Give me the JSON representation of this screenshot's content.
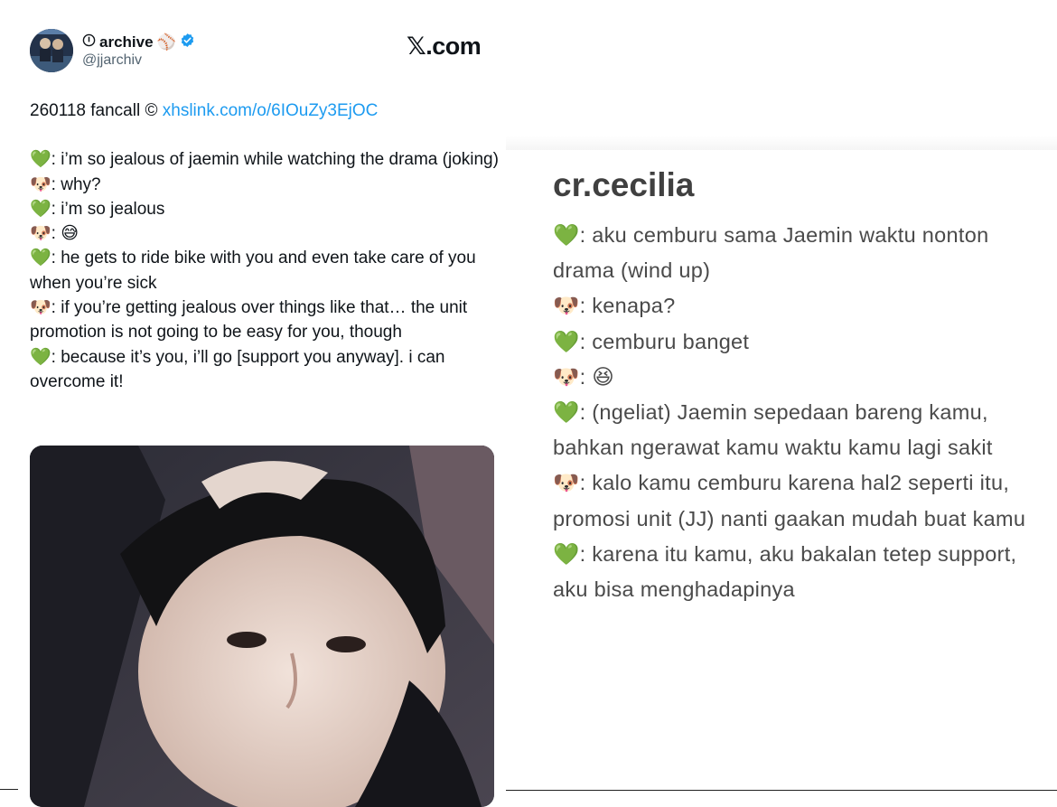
{
  "tweet": {
    "display_name": "archive",
    "name_prefix_icon": "info-circle-icon",
    "name_suffix_emoji": "⚾",
    "handle": "@jjarchiv",
    "verified": true,
    "site_label": "𝕏.com",
    "first_line_text": "260118 fancall © ",
    "first_line_link": "xhslink.com/o/6IOuZy3EjOC",
    "lines": [
      {
        "icon": "💚",
        "text": ": i’m so jealous of jaemin while watching the drama (joking)"
      },
      {
        "icon": "🐶",
        "text": ": why?"
      },
      {
        "icon": "💚",
        "text": ": i’m so jealous"
      },
      {
        "icon": "🐶",
        "text": ": 😅"
      },
      {
        "icon": "💚",
        "text": ": he gets to ride bike with you and even take care of you when you’re sick"
      },
      {
        "icon": "🐶",
        "text": ": if you’re getting jealous over things like that… the unit promotion is not going to be easy for you, though"
      },
      {
        "icon": "💚",
        "text": ": because it’s you, i’ll go [support you anyway]. i can overcome it!"
      }
    ]
  },
  "card": {
    "credit": "cr.cecilia",
    "lines": [
      {
        "icon": "💚",
        "text": ": aku cemburu sama Jaemin waktu nonton drama (wind up)"
      },
      {
        "icon": "🐶",
        "text": ": kenapa?"
      },
      {
        "icon": "💚",
        "text": ": cemburu banget"
      },
      {
        "icon": "🐶",
        "text": ": 😆"
      },
      {
        "icon": "💚",
        "text": ": (ngeliat) Jaemin sepedaan bareng kamu, bahkan ngerawat kamu waktu kamu lagi sakit"
      },
      {
        "icon": "🐶",
        "text": ": kalo kamu cemburu karena hal2 seperti itu, promosi unit (JJ) nanti gaakan mudah buat kamu"
      },
      {
        "icon": "💚",
        "text": ": karena itu kamu, aku bakalan tetep support, aku bisa menghadapinya"
      }
    ]
  },
  "colors": {
    "link": "#1d9bf0",
    "verified": "#1d9bf0",
    "handle": "#536471",
    "card_text": "#4a4a4a"
  }
}
